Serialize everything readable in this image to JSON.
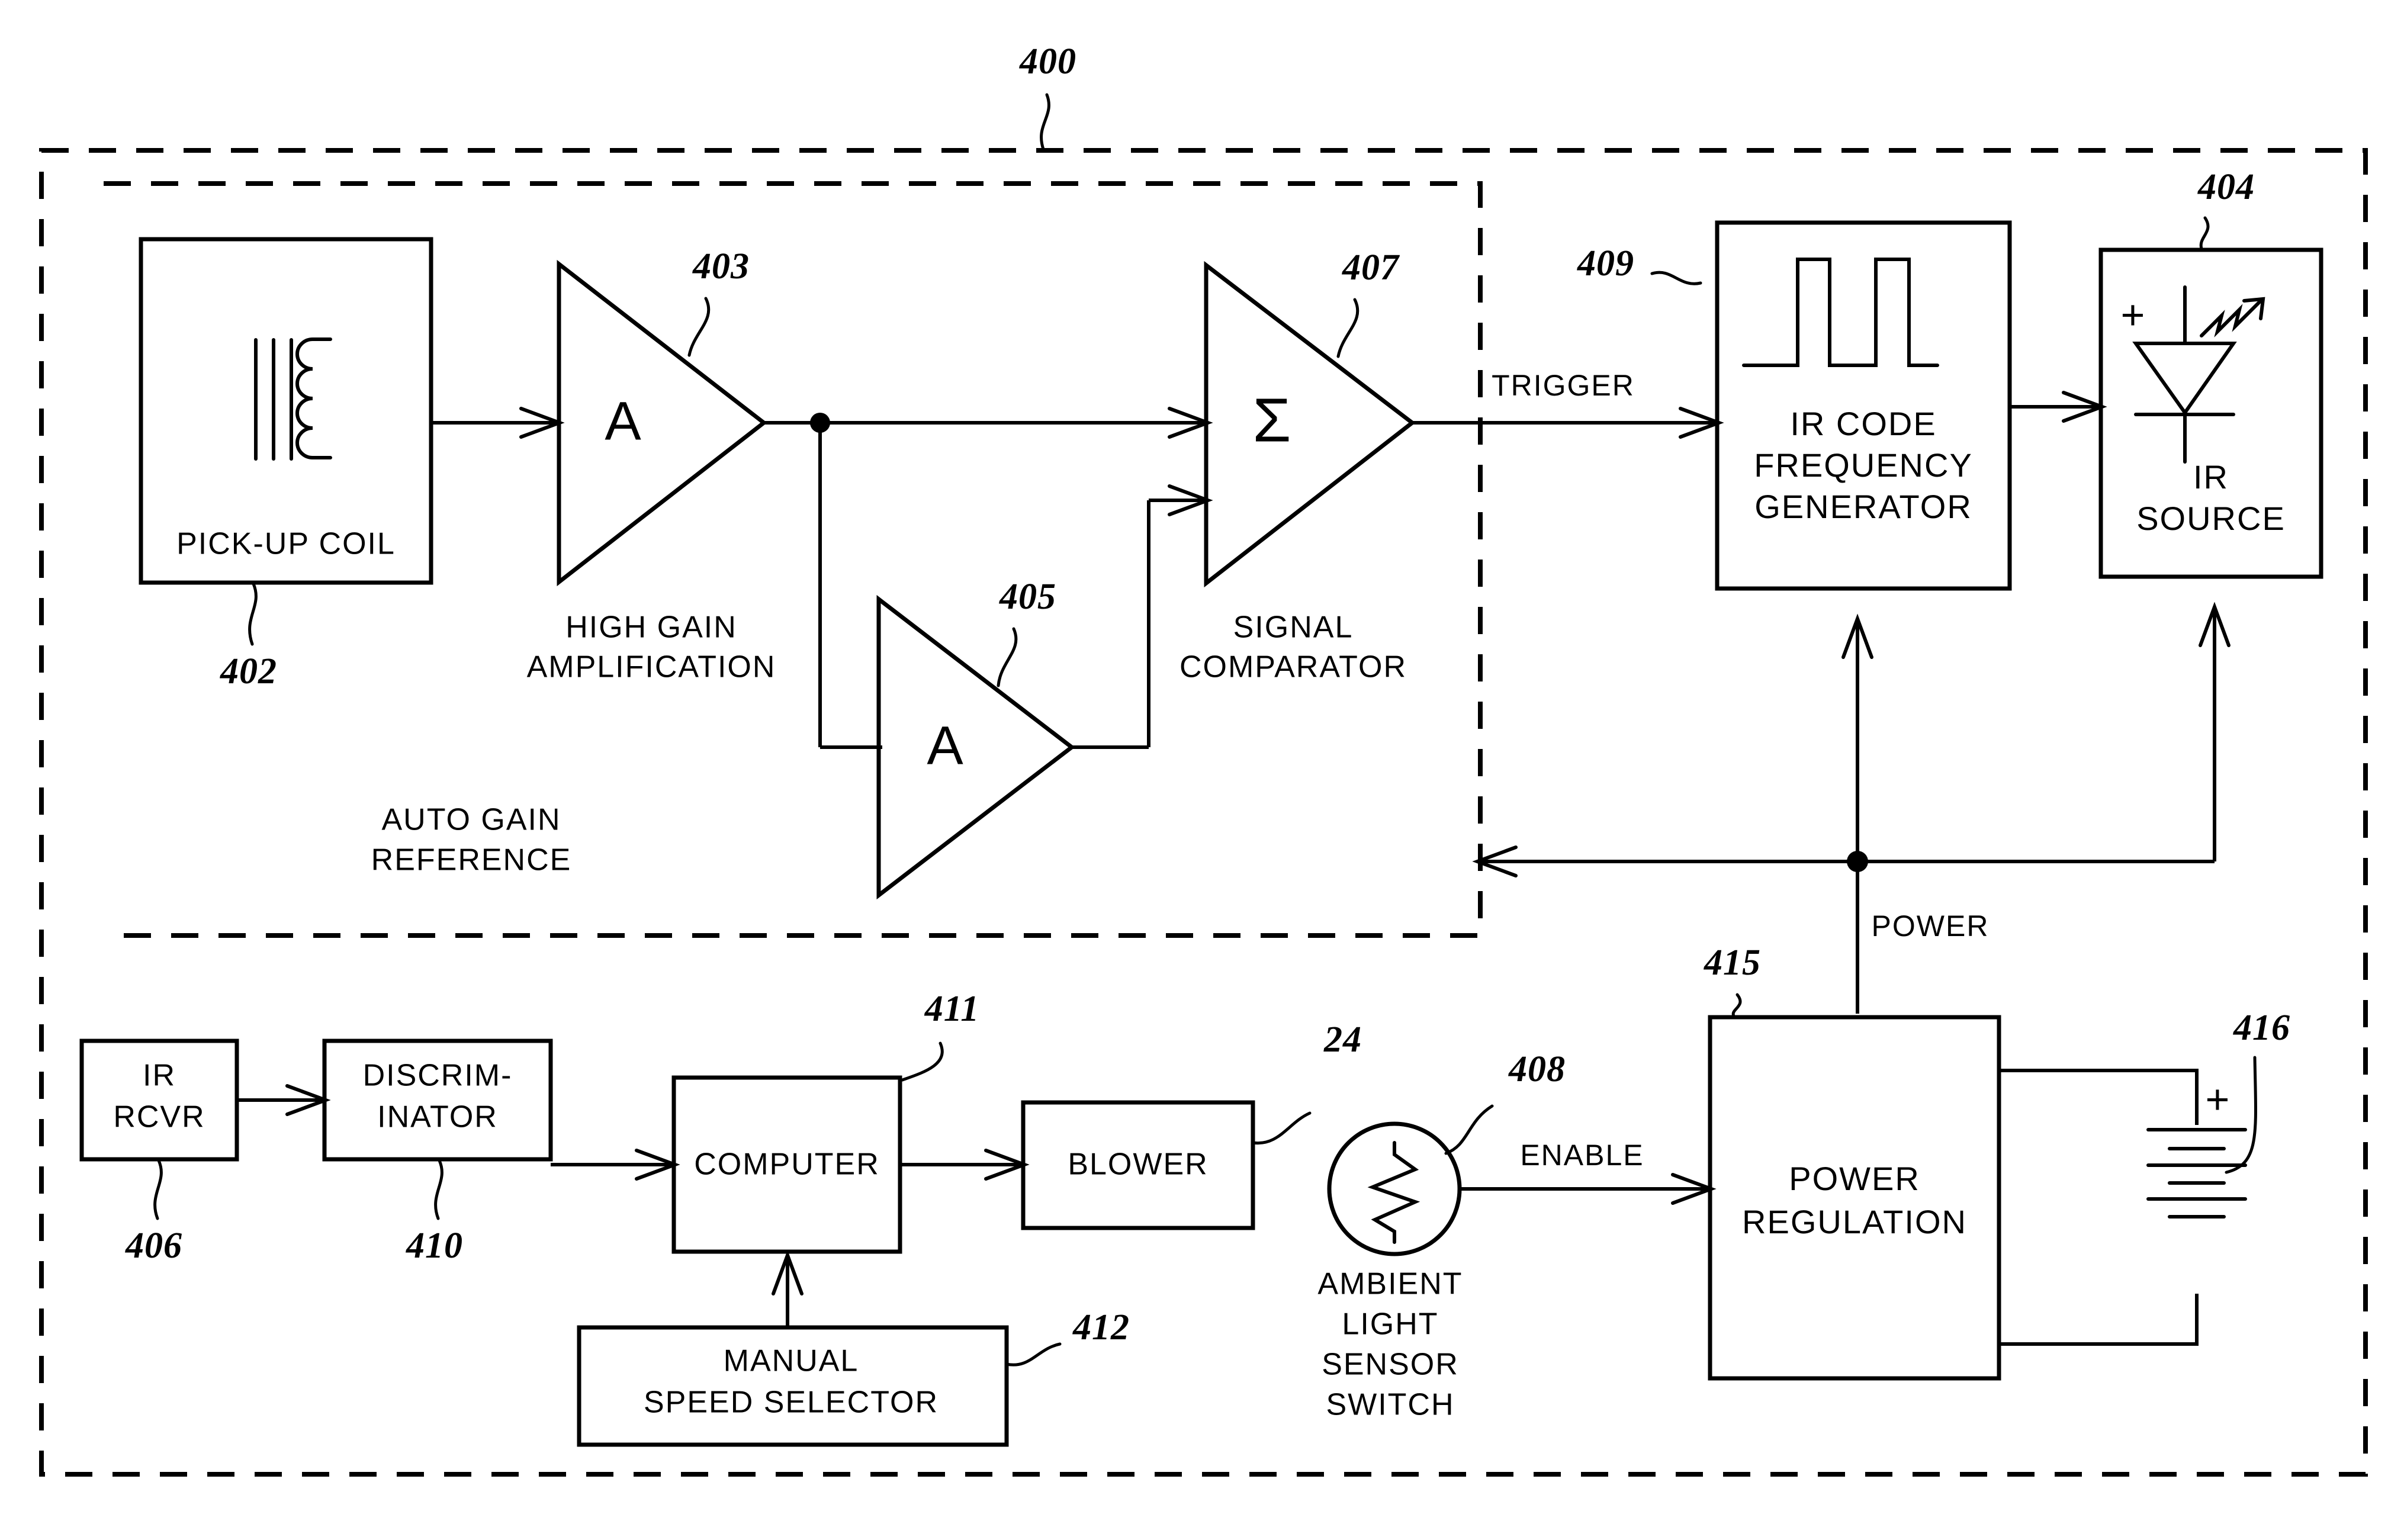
{
  "figure": {
    "number": "400",
    "type": "block-diagram"
  },
  "boundaries": {
    "outer_ref": "400",
    "inner_ref": ""
  },
  "blocks": [
    {
      "id": "pickup_coil",
      "label": "PICK-UP COIL",
      "ref": "402",
      "symbol": "coil-icon"
    },
    {
      "id": "high_gain_amp",
      "label_line1": "HIGH GAIN",
      "label_line2": "AMPLIFICATION",
      "ref": "403",
      "glyph": "A"
    },
    {
      "id": "auto_gain_ref",
      "label_line1": "AUTO GAIN",
      "label_line2": "REFERENCE",
      "ref": "405",
      "glyph": "A"
    },
    {
      "id": "signal_comparator",
      "label_line1": "SIGNAL",
      "label_line2": "COMPARATOR",
      "ref": "407",
      "glyph": "Σ"
    },
    {
      "id": "ir_code_freq_gen",
      "label_line1": "IR CODE",
      "label_line2": "FREQUENCY",
      "label_line3": "GENERATOR",
      "ref": "409",
      "symbol": "pulse-waveform-icon"
    },
    {
      "id": "ir_source",
      "label_line1": "IR",
      "label_line2": "SOURCE",
      "ref": "404",
      "symbol": "led-icon",
      "polarity": "+"
    },
    {
      "id": "ir_rcvr",
      "label_line1": "IR",
      "label_line2": "RCVR",
      "ref": "406"
    },
    {
      "id": "discriminator",
      "label_line1": "DISCRIM-",
      "label_line2": "INATOR",
      "ref": "410"
    },
    {
      "id": "computer",
      "label": "COMPUTER",
      "ref": "411"
    },
    {
      "id": "blower",
      "label": "BLOWER",
      "ref": "24"
    },
    {
      "id": "manual_speed_selector",
      "label_line1": "MANUAL",
      "label_line2": "SPEED SELECTOR",
      "ref": "412"
    },
    {
      "id": "ambient_light_sensor",
      "label_line1": "AMBIENT",
      "label_line2": "LIGHT",
      "label_line3": "SENSOR",
      "label_line4": "SWITCH",
      "ref": "408",
      "symbol": "photoresistor-icon"
    },
    {
      "id": "power_regulation",
      "label_line1": "POWER",
      "label_line2": "REGULATION",
      "ref": "415"
    },
    {
      "id": "battery",
      "ref": "416",
      "symbol": "battery-icon",
      "polarity": "+"
    }
  ],
  "signals": [
    {
      "id": "trigger",
      "label": "TRIGGER"
    },
    {
      "id": "enable",
      "label": "ENABLE"
    },
    {
      "id": "power",
      "label": "POWER"
    }
  ],
  "refs": {
    "r400": "400",
    "r402": "402",
    "r403": "403",
    "r404": "404",
    "r405": "405",
    "r406": "406",
    "r407": "407",
    "r408": "408",
    "r409": "409",
    "r410": "410",
    "r411": "411",
    "r412": "412",
    "r415": "415",
    "r416": "416",
    "r24": "24"
  },
  "colors": {
    "ink": "#000000",
    "paper": "#ffffff"
  }
}
